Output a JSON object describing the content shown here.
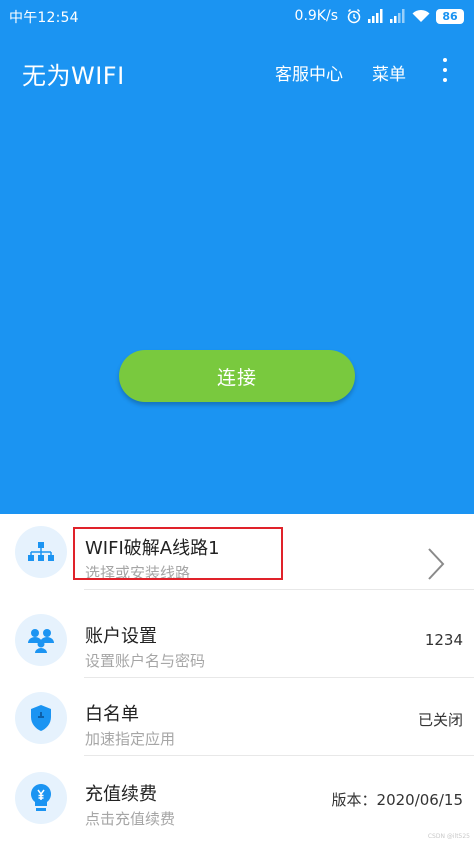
{
  "status_bar": {
    "time": "中午12:54",
    "speed": "0.9K/s",
    "battery": "86"
  },
  "header": {
    "title": "无为WIFI",
    "service_label": "客服中心",
    "menu_label": "菜单"
  },
  "connect_button_label": "连接",
  "list": {
    "items": [
      {
        "title": "WIFI破解A线路1",
        "subtitle": "选择或安装线路",
        "value": ""
      },
      {
        "title": "账户设置",
        "subtitle": "设置账户名与密码",
        "value": "1234"
      },
      {
        "title": "白名单",
        "subtitle": "加速指定应用",
        "value": "已关闭"
      },
      {
        "title": "充值续费",
        "subtitle": "点击充值续费",
        "value": "版本：2020/06/15"
      }
    ]
  },
  "watermark": "CSDN @ilt525",
  "colors": {
    "primary_blue": "#1b94f2",
    "connect_green": "#79c93e",
    "highlight_red": "#e0222a",
    "icon_bg": "#e6f2fd"
  },
  "icons": {
    "line": "network-tree-icon",
    "account": "users-icon",
    "whitelist": "shield-icon",
    "recharge": "lightbulb-yen-icon",
    "more": "more-vertical-icon",
    "chevron": "chevron-right-icon"
  }
}
